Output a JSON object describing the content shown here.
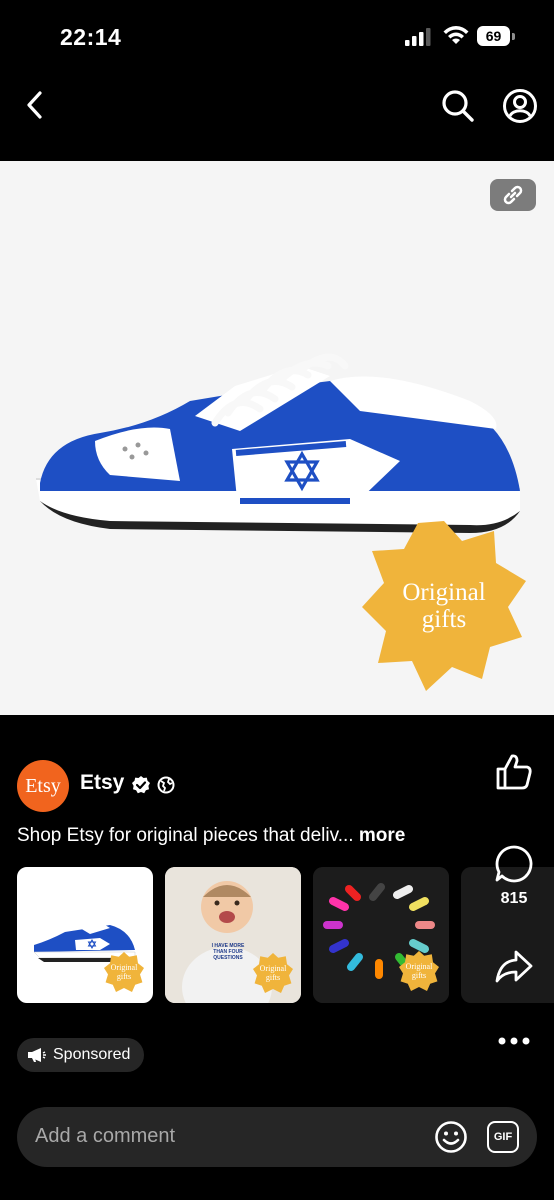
{
  "status": {
    "time": "22:14",
    "battery": "69"
  },
  "nav": {
    "back": "back-arrow-icon",
    "search": "search-icon",
    "profile": "profile-icon"
  },
  "hero": {
    "badge_line1": "Original",
    "badge_line2": "gifts",
    "badge_color": "#f0b43b",
    "shoe_color": "#1e4fc4"
  },
  "post": {
    "avatar_text": "Etsy",
    "brand": "Etsy",
    "description": "Shop Etsy for original pieces that deliv...",
    "more_label": "more",
    "sponsored_label": "Sponsored",
    "accent": "#f1641e"
  },
  "thumbs": [
    {
      "badge": "Original gifts",
      "shirt_text": ""
    },
    {
      "badge": "Original gifts",
      "shirt_text": "I HAVE MORE THAN FOUR QUESTIONS"
    },
    {
      "badge": "Original gifts",
      "shirt_text": ""
    }
  ],
  "actions": {
    "comments_count": "815"
  },
  "comment": {
    "placeholder": "Add a comment",
    "gif_label": "GIF"
  }
}
